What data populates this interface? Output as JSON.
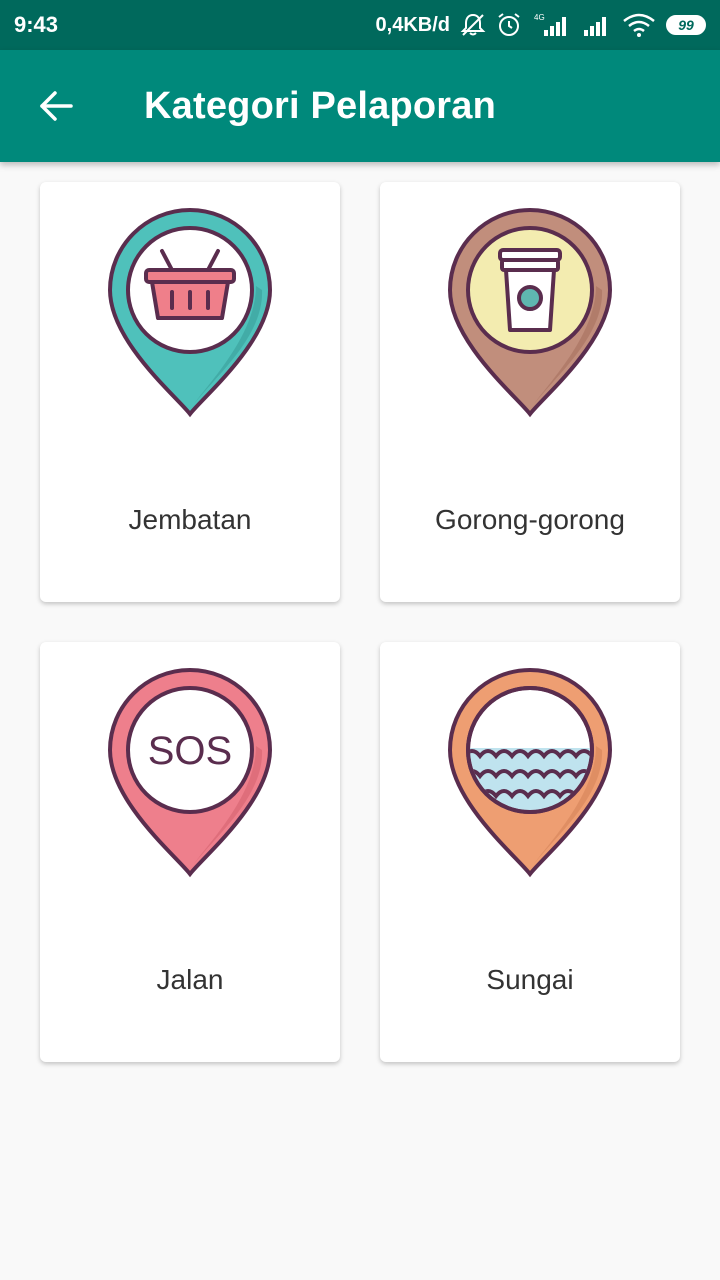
{
  "status_bar": {
    "time": "9:43",
    "net_speed": "0,4KB/d",
    "network_type": "4G",
    "battery": "99",
    "icons": [
      "notification-off-icon",
      "alarm-icon",
      "signal-icon",
      "signal-icon",
      "wifi-icon",
      "battery-icon"
    ]
  },
  "app_bar": {
    "title": "Kategori Pelaporan",
    "back_icon": "arrow-back-icon",
    "color": "#00897b",
    "status_color": "#00695c"
  },
  "categories": [
    {
      "label": "Jembatan",
      "icon": "basket-pin-icon",
      "pin_color": "#4fc1bb"
    },
    {
      "label": "Gorong-gorong",
      "icon": "coffee-cup-pin-icon",
      "pin_color": "#c18e7c"
    },
    {
      "label": "Jalan",
      "icon": "sos-pin-icon",
      "pin_color": "#ee7f8c",
      "icon_text": "SOS"
    },
    {
      "label": "Sungai",
      "icon": "waves-pin-icon",
      "pin_color": "#ee9e72"
    }
  ]
}
